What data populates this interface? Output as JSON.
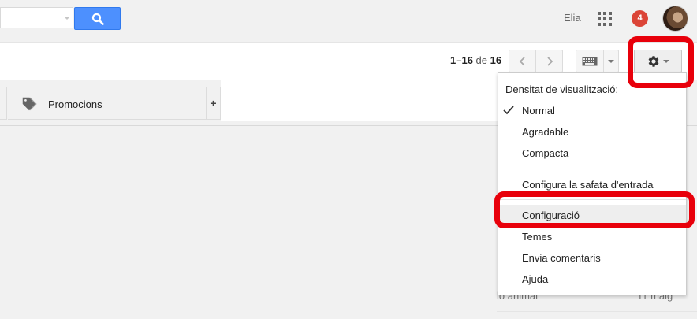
{
  "header": {
    "search_placeholder": "",
    "search_icon": "search-icon",
    "username": "Elia",
    "notifications_count": "4",
    "apps_icon": "apps-grid-icon",
    "accent_color": "#4d90fe",
    "badge_color": "#db4437"
  },
  "toolbar": {
    "pager_range": "1–16",
    "pager_of": "de",
    "pager_total": "16",
    "prev_icon": "chevron-left-icon",
    "next_icon": "chevron-right-icon",
    "keyboard_icon": "keyboard-icon",
    "settings_icon": "gear-icon"
  },
  "tabs": {
    "promotions_label": "Promocions",
    "add_label": "+"
  },
  "background": {
    "row_text": "lo animal",
    "row_date": "11 maig"
  },
  "menu": {
    "density_header": "Densitat de visualització:",
    "density_options": [
      {
        "label": "Normal",
        "checked": true
      },
      {
        "label": "Agradable",
        "checked": false
      },
      {
        "label": "Compacta",
        "checked": false
      }
    ],
    "configure_inbox": "Configura la safata d'entrada",
    "settings": "Configuració",
    "themes": "Temes",
    "send_feedback": "Envia comentaris",
    "help": "Ajuda"
  },
  "annotation": {
    "highlight_color": "#e8000b"
  }
}
